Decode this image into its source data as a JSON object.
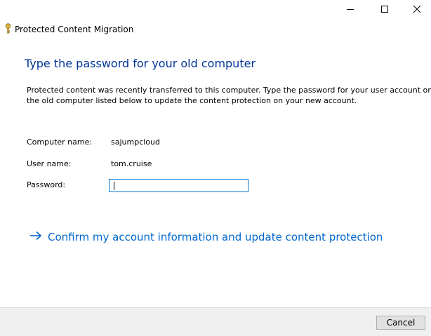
{
  "window": {
    "title": "Protected Content Migration",
    "icon": "key-icon"
  },
  "caption_buttons": {
    "minimize": "minimize-icon",
    "maximize": "maximize-icon",
    "close": "close-icon"
  },
  "main": {
    "heading": "Type the password for your old computer",
    "description_line1": "Protected content was recently transferred to this computer.  Type the password for your user account on",
    "description_line2": "the old computer listed below to update the content protection on your new account.",
    "fields": {
      "computer_name_label": "Computer name:",
      "computer_name_value": "sajumpcloud",
      "user_name_label": "User name:",
      "user_name_value": "tom.cruise",
      "password_label": "Password:",
      "password_value": ""
    },
    "command_link": {
      "icon": "arrow-right-icon",
      "label": "Confirm my account information and update content protection"
    }
  },
  "footer": {
    "cancel_label": "Cancel"
  },
  "colors": {
    "heading": "#003399",
    "link": "#0066cc",
    "input_border": "#0078d7",
    "footer_bg": "#f0f0f0"
  }
}
